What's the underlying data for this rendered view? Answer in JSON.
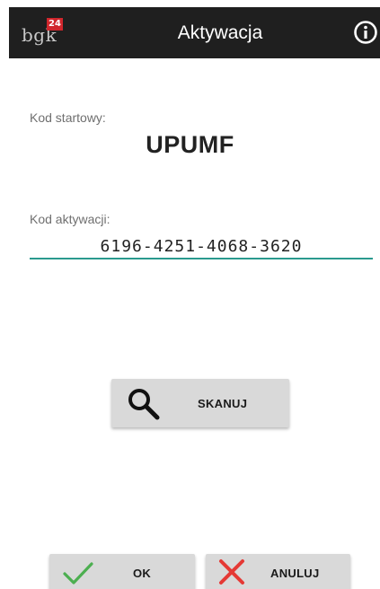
{
  "app": {
    "logo_text": "bgk",
    "logo_badge": "24",
    "title": "Aktywacja",
    "info_icon": "info-icon"
  },
  "start_code": {
    "label": "Kod startowy:",
    "value": "UPUMF"
  },
  "activation_code": {
    "label": "Kod aktywacji:",
    "value": "6196-4251-4068-3620"
  },
  "buttons": {
    "scan_label": "SKANUJ",
    "scan_icon": "search-icon",
    "ok_label": "OK",
    "ok_icon": "checkmark-icon",
    "cancel_label": "ANULUJ",
    "cancel_icon": "close-icon"
  },
  "colors": {
    "topbar": "#1f1f1f",
    "accent_underline": "#2a9a8e",
    "logo_badge": "#d0262c",
    "ok_check": "#4caf50",
    "cancel_x": "#e53935"
  }
}
